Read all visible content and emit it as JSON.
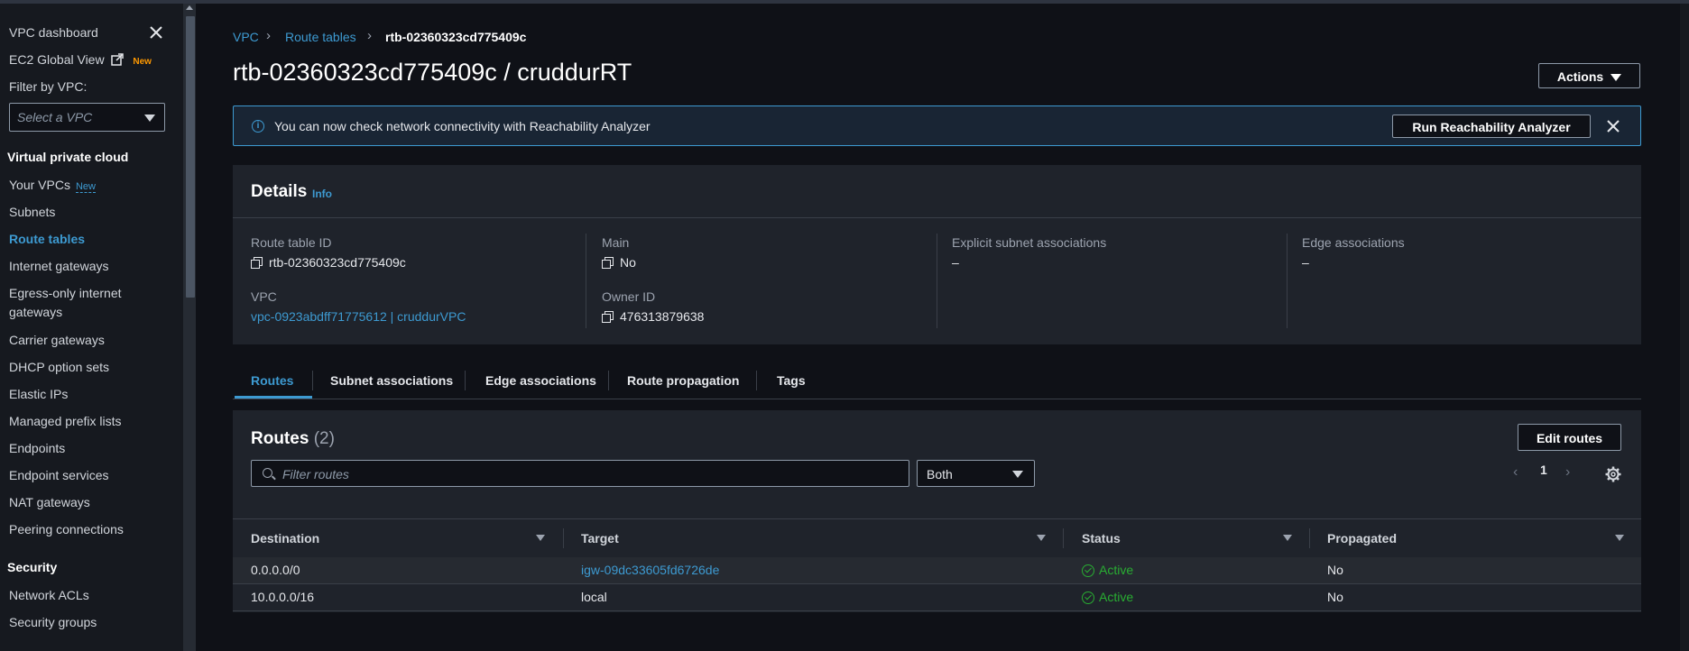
{
  "sidebar": {
    "vpc_dashboard": "VPC dashboard",
    "ec2_global_view": "EC2 Global View",
    "new_badge": "New",
    "filter_label": "Filter by VPC:",
    "filter_placeholder": "Select a VPC",
    "section_vpc": "Virtual private cloud",
    "your_vpcs": "Your VPCs",
    "items": [
      "Subnets",
      "Route tables",
      "Internet gateways",
      "Egress-only internet",
      "gateways",
      "Carrier gateways",
      "DHCP option sets",
      "Elastic IPs",
      "Managed prefix lists",
      "Endpoints",
      "Endpoint services",
      "NAT gateways",
      "Peering connections"
    ],
    "section_security": "Security",
    "security_items": [
      "Network ACLs",
      "Security groups"
    ]
  },
  "breadcrumb": {
    "vpc": "VPC",
    "route_tables": "Route tables",
    "current": "rtb-02360323cd775409c"
  },
  "page": {
    "title": "rtb-02360323cd775409c / cruddurRT",
    "actions_label": "Actions"
  },
  "banner": {
    "text": "You can now check network connectivity with Reachability Analyzer",
    "button": "Run Reachability Analyzer"
  },
  "details": {
    "title": "Details",
    "info": "Info",
    "route_table_id_label": "Route table ID",
    "route_table_id": "rtb-02360323cd775409c",
    "main_label": "Main",
    "main_value": "No",
    "explicit_label": "Explicit subnet associations",
    "explicit_value": "–",
    "edge_label": "Edge associations",
    "edge_value": "–",
    "vpc_label": "VPC",
    "vpc_value": "vpc-0923abdff71775612 | cruddurVPC",
    "owner_label": "Owner ID",
    "owner_value": "476313879638"
  },
  "tabs": [
    "Routes",
    "Subnet associations",
    "Edge associations",
    "Route propagation",
    "Tags"
  ],
  "routes": {
    "title": "Routes",
    "count": "(2)",
    "edit_button": "Edit routes",
    "filter_placeholder": "Filter routes",
    "select_value": "Both",
    "page_number": "1",
    "columns": [
      "Destination",
      "Target",
      "Status",
      "Propagated"
    ],
    "rows": [
      {
        "destination": "0.0.0.0/0",
        "target": "igw-09dc33605fd6726de",
        "status": "Active",
        "propagated": "No"
      },
      {
        "destination": "10.0.0.0/16",
        "target": "local",
        "status": "Active",
        "propagated": "No"
      }
    ]
  },
  "colors": {
    "accent": "#3d9ad1",
    "active_status": "#29ad32",
    "new_badge": "#ff9900",
    "background": "#0f1117"
  },
  "icons": [
    "close-icon",
    "external-link-icon",
    "info-icon",
    "copy-icon",
    "search-icon",
    "settings-gear-icon",
    "check-circle-icon",
    "chevron-left-icon",
    "chevron-right-icon",
    "sort-caret-icon"
  ]
}
